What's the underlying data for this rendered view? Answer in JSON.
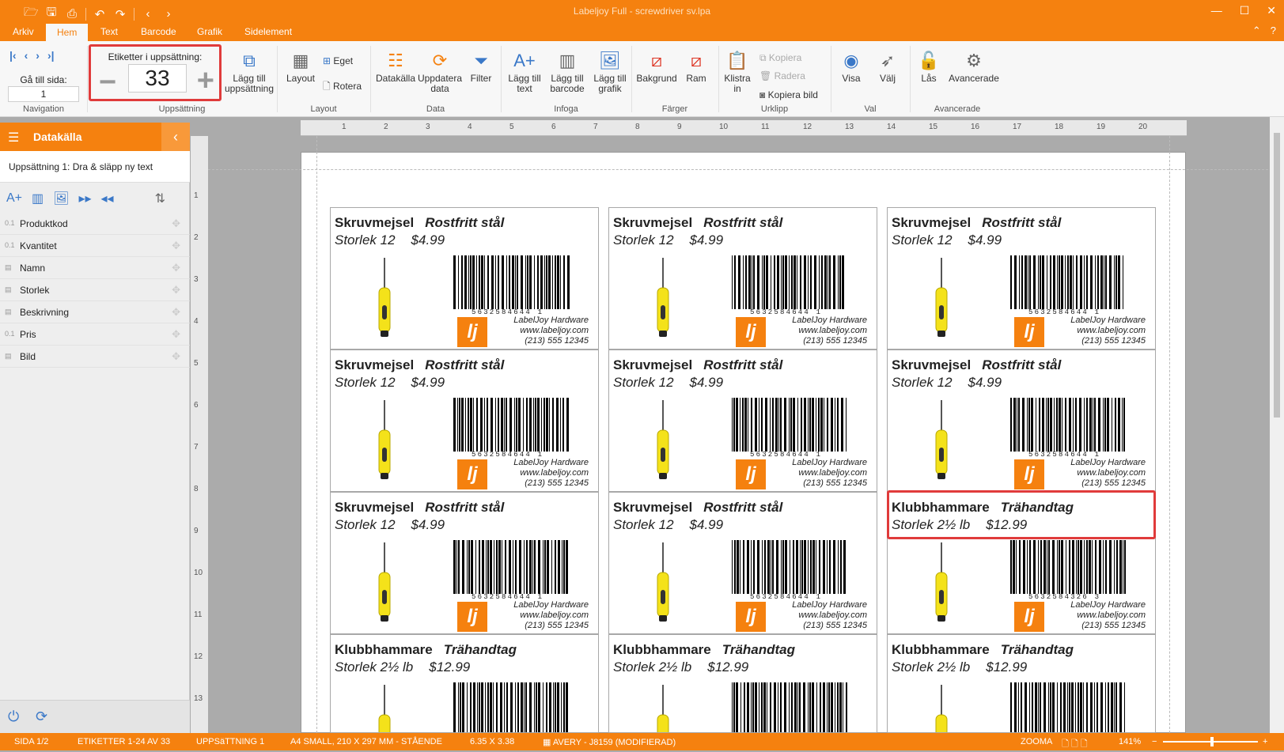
{
  "app": {
    "title": "Labeljoy Full - screwdriver sv.lpa"
  },
  "quick_access": {
    "icons": [
      "open-icon",
      "save-icon",
      "print-icon",
      "undo-icon",
      "redo-icon",
      "back-icon",
      "forward-icon"
    ]
  },
  "menu": {
    "tabs": [
      "Arkiv",
      "Hem",
      "Text",
      "Barcode",
      "Grafik",
      "Sidelement"
    ],
    "active": "Hem",
    "right": [
      "⌃",
      "?"
    ]
  },
  "ribbon": {
    "navigation": {
      "goto_label": "Gå till sida:",
      "page_value": "1",
      "group": "Navigation"
    },
    "layout_group": {
      "counter_title": "Etiketter i uppsättning:",
      "counter_value": "33",
      "add_label": "Lägg till uppsättning",
      "group": "Uppsättning"
    },
    "layout": {
      "layout": "Layout",
      "eget": "Eget",
      "rotera": "Rotera",
      "group": "Layout"
    },
    "data": {
      "datakalla": "Datakälla",
      "uppdatera": "Uppdatera data",
      "filter": "Filter",
      "group": "Data"
    },
    "infoga": {
      "text": "Lägg till text",
      "barcode": "Lägg till barcode",
      "grafik": "Lägg till grafik",
      "group": "Infoga"
    },
    "farger": {
      "bakgrund": "Bakgrund",
      "ram": "Ram",
      "group": "Färger"
    },
    "urklipp": {
      "klistra": "Klistra in",
      "kopiera": "Kopiera",
      "radera": "Radera",
      "kopiera_bild": "Kopiera bild",
      "group": "Urklipp"
    },
    "val": {
      "visa": "Visa",
      "valj": "Välj",
      "group": "Val"
    },
    "avancerade": {
      "las": "Lås",
      "avancerade": "Avancerade",
      "group": "Avancerade"
    }
  },
  "panel": {
    "title": "Datakälla",
    "subtitle": "Uppsättning 1: Dra & släpp ny text",
    "fields": [
      {
        "type": "0.1",
        "name": "Produktkod"
      },
      {
        "type": "0.1",
        "name": "Kvantitet"
      },
      {
        "type": "",
        "name": "Namn"
      },
      {
        "type": "",
        "name": "Storlek"
      },
      {
        "type": "",
        "name": "Beskrivning"
      },
      {
        "type": "0.1",
        "name": "Pris"
      },
      {
        "type": "",
        "name": "Bild"
      }
    ]
  },
  "rulers": {
    "h": [
      "1",
      "2",
      "3",
      "4",
      "5",
      "6",
      "7",
      "8",
      "9",
      "10",
      "11",
      "12",
      "13",
      "14",
      "15",
      "16",
      "17",
      "18",
      "19",
      "20"
    ],
    "v": [
      "1",
      "2",
      "3",
      "4",
      "5",
      "6",
      "7",
      "8",
      "9",
      "10",
      "11",
      "12",
      "13"
    ]
  },
  "labels": {
    "rows": [
      [
        {
          "name": "Skruvmejsel",
          "desc": "Rostfritt stål",
          "size": "Storlek 12",
          "price": "$4.99",
          "code": "5632584644 1"
        },
        {
          "name": "Skruvmejsel",
          "desc": "Rostfritt stål",
          "size": "Storlek 12",
          "price": "$4.99",
          "code": "5632584644 1"
        },
        {
          "name": "Skruvmejsel",
          "desc": "Rostfritt stål",
          "size": "Storlek 12",
          "price": "$4.99",
          "code": "5632584644 1"
        }
      ],
      [
        {
          "name": "Skruvmejsel",
          "desc": "Rostfritt stål",
          "size": "Storlek 12",
          "price": "$4.99",
          "code": "5632584644 1"
        },
        {
          "name": "Skruvmejsel",
          "desc": "Rostfritt stål",
          "size": "Storlek 12",
          "price": "$4.99",
          "code": "5632584644 1"
        },
        {
          "name": "Skruvmejsel",
          "desc": "Rostfritt stål",
          "size": "Storlek 12",
          "price": "$4.99",
          "code": "5632584644 1"
        }
      ],
      [
        {
          "name": "Skruvmejsel",
          "desc": "Rostfritt stål",
          "size": "Storlek 12",
          "price": "$4.99",
          "code": "5632584644 1"
        },
        {
          "name": "Skruvmejsel",
          "desc": "Rostfritt stål",
          "size": "Storlek 12",
          "price": "$4.99",
          "code": "5632584644 1"
        },
        {
          "name": "Klubbhammare",
          "desc": "Trähandtag",
          "size": "Storlek 2½ lb",
          "price": "$12.99",
          "code": "5632584326 3"
        }
      ],
      [
        {
          "name": "Klubbhammare",
          "desc": "Trähandtag",
          "size": "Storlek 2½ lb",
          "price": "$12.99",
          "code": ""
        },
        {
          "name": "Klubbhammare",
          "desc": "Trähandtag",
          "size": "Storlek 2½ lb",
          "price": "$12.99",
          "code": ""
        },
        {
          "name": "Klubbhammare",
          "desc": "Trähandtag",
          "size": "Storlek 2½ lb",
          "price": "$12.99",
          "code": ""
        }
      ]
    ],
    "company": [
      "LabelJoy Hardware",
      "www.labeljoy.com",
      "(213) 555 12345"
    ],
    "logo": "lj"
  },
  "status": {
    "sida": "SIDA 1/2",
    "etiketter": "ETIKETTER 1-24 AV 33",
    "uppsattning": "UPPSäTTNING 1",
    "paper": "A4 SMALL, 210 X 297 MM - STÅENDE",
    "size": "6.35 X 3.38",
    "avery": "AVERY - J8159 (MODIFIERAD)",
    "zoom_label": "ZOOMA",
    "zoom_value": "141%",
    "minus": "−",
    "plus": "+"
  },
  "colors": {
    "accent": "#f5810f",
    "highlight": "#e03b3b"
  }
}
